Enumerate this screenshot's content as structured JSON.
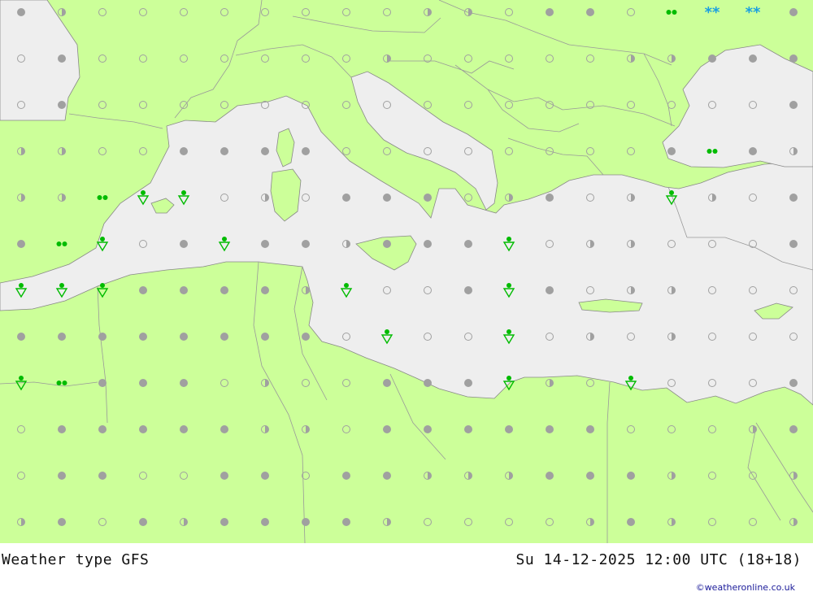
{
  "map": {
    "colors": {
      "land": "#ccff99",
      "sea": "#eeeeee",
      "border": "#999999",
      "coast": "#888888",
      "cloud_marker": "#a0a0a0",
      "rain_marker": "#00bb00",
      "snow_marker": "#1a9fe0"
    },
    "legend": {
      "weather_types": [
        "clear",
        "partly-cloudy",
        "overcast",
        "rain",
        "shower",
        "snow"
      ]
    },
    "grid": {
      "cols": 20,
      "rows": 12,
      "cells": [
        "oc",
        "pc",
        "cl",
        "cl",
        "cl",
        "cl",
        "cl",
        "cl",
        "cl",
        "cl",
        "pc",
        "pc",
        "cl",
        "oc",
        "oc",
        "cl",
        "ra",
        "sn",
        "sn",
        "oc",
        "cl",
        "oc",
        "cl",
        "cl",
        "cl",
        "cl",
        "cl",
        "cl",
        "cl",
        "pc",
        "cl",
        "cl",
        "cl",
        "cl",
        "cl",
        "pc",
        "pc",
        "oc",
        "oc",
        "oc",
        "cl",
        "oc",
        "cl",
        "cl",
        "cl",
        "cl",
        "cl",
        "cl",
        "cl",
        "cl",
        "cl",
        "cl",
        "cl",
        "cl",
        "cl",
        "cl",
        "cl",
        "cl",
        "cl",
        "oc",
        "pc",
        "pc",
        "cl",
        "cl",
        "oc",
        "oc",
        "oc",
        "oc",
        "cl",
        "cl",
        "cl",
        "cl",
        "cl",
        "cl",
        "cl",
        "cl",
        "oc",
        "ra",
        "oc",
        "pc",
        "pc",
        "pc",
        "ra",
        "sh",
        "sh",
        "cl",
        "pc",
        "cl",
        "oc",
        "oc",
        "oc",
        "cl",
        "pc",
        "oc",
        "cl",
        "pc",
        "sh",
        "pc",
        "cl",
        "oc",
        "oc",
        "ra",
        "sh",
        "cl",
        "oc",
        "sh",
        "oc",
        "oc",
        "pc",
        "oc",
        "oc",
        "oc",
        "sh",
        "cl",
        "pc",
        "pc",
        "cl",
        "cl",
        "cl",
        "oc",
        "sh",
        "sh",
        "sh",
        "oc",
        "oc",
        "oc",
        "oc",
        "pc",
        "sh",
        "cl",
        "cl",
        "oc",
        "sh",
        "oc",
        "cl",
        "pc",
        "pc",
        "cl",
        "cl",
        "cl",
        "oc",
        "oc",
        "oc",
        "oc",
        "oc",
        "oc",
        "oc",
        "oc",
        "cl",
        "sh",
        "cl",
        "cl",
        "sh",
        "cl",
        "pc",
        "cl",
        "pc",
        "cl",
        "cl",
        "cl",
        "sh",
        "ra",
        "oc",
        "oc",
        "oc",
        "cl",
        "pc",
        "cl",
        "cl",
        "oc",
        "oc",
        "oc",
        "sh",
        "pc",
        "cl",
        "sh",
        "cl",
        "cl",
        "cl",
        "oc",
        "cl",
        "oc",
        "oc",
        "oc",
        "oc",
        "oc",
        "pc",
        "pc",
        "cl",
        "oc",
        "oc",
        "oc",
        "oc",
        "oc",
        "oc",
        "cl",
        "cl",
        "cl",
        "pc",
        "oc",
        "cl",
        "oc",
        "oc",
        "cl",
        "cl",
        "oc",
        "oc",
        "cl",
        "oc",
        "oc",
        "pc",
        "pc",
        "pc",
        "oc",
        "oc",
        "oc",
        "pc",
        "cl",
        "cl",
        "pc",
        "pc",
        "oc",
        "cl",
        "oc",
        "pc",
        "oc",
        "oc",
        "oc",
        "oc",
        "pc",
        "cl",
        "cl",
        "cl",
        "cl",
        "pc",
        "oc",
        "pc",
        "cl",
        "cl",
        "pc"
      ]
    }
  },
  "footer": {
    "title": "Weather type  GFS",
    "datetime": "Su 14-12-2025 12:00 UTC (18+18)",
    "credit": "©weatheronline.co.uk"
  }
}
